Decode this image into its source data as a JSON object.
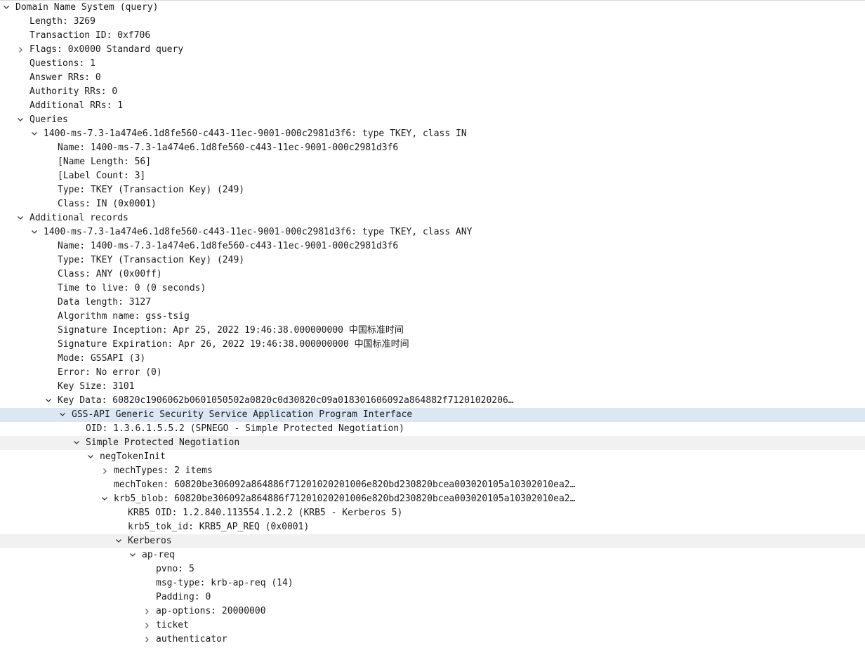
{
  "tree": [
    {
      "text": "Domain Name System (query)",
      "level": 0,
      "toggle": "open"
    },
    {
      "text": "Length: 3269",
      "level": 1,
      "toggle": "none"
    },
    {
      "text": "Transaction ID: 0xf706",
      "level": 1,
      "toggle": "none"
    },
    {
      "text": "Flags: 0x0000 Standard query",
      "level": 1,
      "toggle": "closed"
    },
    {
      "text": "Questions: 1",
      "level": 1,
      "toggle": "none"
    },
    {
      "text": "Answer RRs: 0",
      "level": 1,
      "toggle": "none"
    },
    {
      "text": "Authority RRs: 0",
      "level": 1,
      "toggle": "none"
    },
    {
      "text": "Additional RRs: 1",
      "level": 1,
      "toggle": "none"
    },
    {
      "text": "Queries",
      "level": 1,
      "toggle": "open"
    },
    {
      "text": "1400-ms-7.3-1a474e6.1d8fe560-c443-11ec-9001-000c2981d3f6: type TKEY, class IN",
      "level": 2,
      "toggle": "open"
    },
    {
      "text": "Name: 1400-ms-7.3-1a474e6.1d8fe560-c443-11ec-9001-000c2981d3f6",
      "level": 3,
      "toggle": "none"
    },
    {
      "text": "[Name Length: 56]",
      "level": 3,
      "toggle": "none"
    },
    {
      "text": "[Label Count: 3]",
      "level": 3,
      "toggle": "none"
    },
    {
      "text": "Type: TKEY (Transaction Key) (249)",
      "level": 3,
      "toggle": "none"
    },
    {
      "text": "Class: IN (0x0001)",
      "level": 3,
      "toggle": "none"
    },
    {
      "text": "Additional records",
      "level": 1,
      "toggle": "open"
    },
    {
      "text": "1400-ms-7.3-1a474e6.1d8fe560-c443-11ec-9001-000c2981d3f6: type TKEY, class ANY",
      "level": 2,
      "toggle": "open"
    },
    {
      "text": "Name: 1400-ms-7.3-1a474e6.1d8fe560-c443-11ec-9001-000c2981d3f6",
      "level": 3,
      "toggle": "none"
    },
    {
      "text": "Type: TKEY (Transaction Key) (249)",
      "level": 3,
      "toggle": "none"
    },
    {
      "text": "Class: ANY (0x00ff)",
      "level": 3,
      "toggle": "none"
    },
    {
      "text": "Time to live: 0 (0 seconds)",
      "level": 3,
      "toggle": "none"
    },
    {
      "text": "Data length: 3127",
      "level": 3,
      "toggle": "none"
    },
    {
      "text": "Algorithm name: gss-tsig",
      "level": 3,
      "toggle": "none"
    },
    {
      "text": "Signature Inception: Apr 25, 2022 19:46:38.000000000 中国标准时间",
      "level": 3,
      "toggle": "none"
    },
    {
      "text": "Signature Expiration: Apr 26, 2022 19:46:38.000000000 中国标准时间",
      "level": 3,
      "toggle": "none"
    },
    {
      "text": "Mode: GSSAPI (3)",
      "level": 3,
      "toggle": "none"
    },
    {
      "text": "Error: No error (0)",
      "level": 3,
      "toggle": "none"
    },
    {
      "text": "Key Size: 3101",
      "level": 3,
      "toggle": "none"
    },
    {
      "text": "Key Data: 60820c1906062b0601050502a0820c0d30820c09a018301606092a864882f71201020206…",
      "level": 3,
      "toggle": "open"
    },
    {
      "text": "GSS-API Generic Security Service Application Program Interface",
      "level": 4,
      "toggle": "open",
      "style": "sel"
    },
    {
      "text": "OID: 1.3.6.1.5.5.2 (SPNEGO - Simple Protected Negotiation)",
      "level": 5,
      "toggle": "none"
    },
    {
      "text": "Simple Protected Negotiation",
      "level": 5,
      "toggle": "open",
      "style": "hl"
    },
    {
      "text": "negTokenInit",
      "level": 6,
      "toggle": "open"
    },
    {
      "text": "mechTypes: 2 items",
      "level": 7,
      "toggle": "closed"
    },
    {
      "text": "mechToken: 60820be306092a864886f71201020201006e820bd230820bcea003020105a10302010ea2…",
      "level": 7,
      "toggle": "none"
    },
    {
      "text": "krb5_blob: 60820be306092a864886f71201020201006e820bd230820bcea003020105a10302010ea2…",
      "level": 7,
      "toggle": "open"
    },
    {
      "text": "KRB5 OID: 1.2.840.113554.1.2.2 (KRB5 - Kerberos 5)",
      "level": 8,
      "toggle": "none"
    },
    {
      "text": "krb5_tok_id: KRB5_AP_REQ (0x0001)",
      "level": 8,
      "toggle": "none"
    },
    {
      "text": "Kerberos",
      "level": 8,
      "toggle": "open",
      "style": "hl"
    },
    {
      "text": "ap-req",
      "level": 9,
      "toggle": "open"
    },
    {
      "text": "pvno: 5",
      "level": 10,
      "toggle": "none"
    },
    {
      "text": "msg-type: krb-ap-req (14)",
      "level": 10,
      "toggle": "none"
    },
    {
      "text": "Padding: 0",
      "level": 10,
      "toggle": "none"
    },
    {
      "text": "ap-options: 20000000",
      "level": 10,
      "toggle": "closed"
    },
    {
      "text": "ticket",
      "level": 10,
      "toggle": "closed"
    },
    {
      "text": "authenticator",
      "level": 10,
      "toggle": "closed"
    }
  ],
  "icons": {
    "open": "chevron-down-icon",
    "closed": "chevron-right-icon"
  },
  "colors": {
    "selected_row": "#dbe7f3",
    "highlight_row": "#f1f1f1",
    "text": "#1a1a1a"
  }
}
